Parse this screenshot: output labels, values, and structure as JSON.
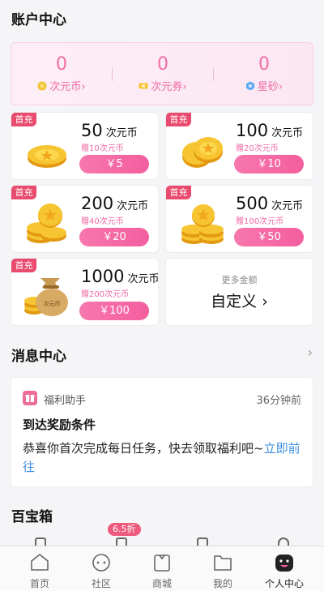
{
  "account": {
    "title": "账户中心",
    "balances": [
      {
        "value": "0",
        "label": "次元币",
        "icon": "coin-icon"
      },
      {
        "value": "0",
        "label": "次元券",
        "icon": "ticket-icon"
      },
      {
        "value": "0",
        "label": "星砂",
        "icon": "star-sand-icon"
      }
    ],
    "chevron": "›"
  },
  "packs": [
    {
      "tag": "首充",
      "amount": "50",
      "unit": "次元币",
      "gift": "赠10次元币",
      "price": "￥5"
    },
    {
      "tag": "首充",
      "amount": "100",
      "unit": "次元币",
      "gift": "赠20次元币",
      "price": "￥10"
    },
    {
      "tag": "首充",
      "amount": "200",
      "unit": "次元币",
      "gift": "赠40次元币",
      "price": "￥20"
    },
    {
      "tag": "首充",
      "amount": "500",
      "unit": "次元币",
      "gift": "赠100次元币",
      "price": "￥50"
    },
    {
      "tag": "首充",
      "amount": "1000",
      "unit": "次元币",
      "gift": "赠200次元币",
      "price": "￥100"
    }
  ],
  "bag_text": "次元币",
  "more": {
    "sub": "更多金额",
    "main": "自定义",
    "chevron": "›"
  },
  "messages": {
    "title": "消息中心",
    "chevron": "›",
    "sender": "福利助手",
    "time": "36分钟前",
    "heading": "到达奖励条件",
    "body": "恭喜你首次完成每日任务，快去领取福利吧~",
    "link": "立即前往"
  },
  "treasure": {
    "title": "百宝箱",
    "badge": "6.5折"
  },
  "tabs": [
    {
      "label": "首页",
      "icon": "home-icon"
    },
    {
      "label": "社区",
      "icon": "community-icon"
    },
    {
      "label": "商城",
      "icon": "mall-icon"
    },
    {
      "label": "我的",
      "icon": "folder-icon"
    },
    {
      "label": "个人中心",
      "icon": "profile-icon"
    }
  ],
  "colors": {
    "accent": "#f35e9e",
    "tag": "#e94b6f",
    "link": "#3b8ee0"
  }
}
